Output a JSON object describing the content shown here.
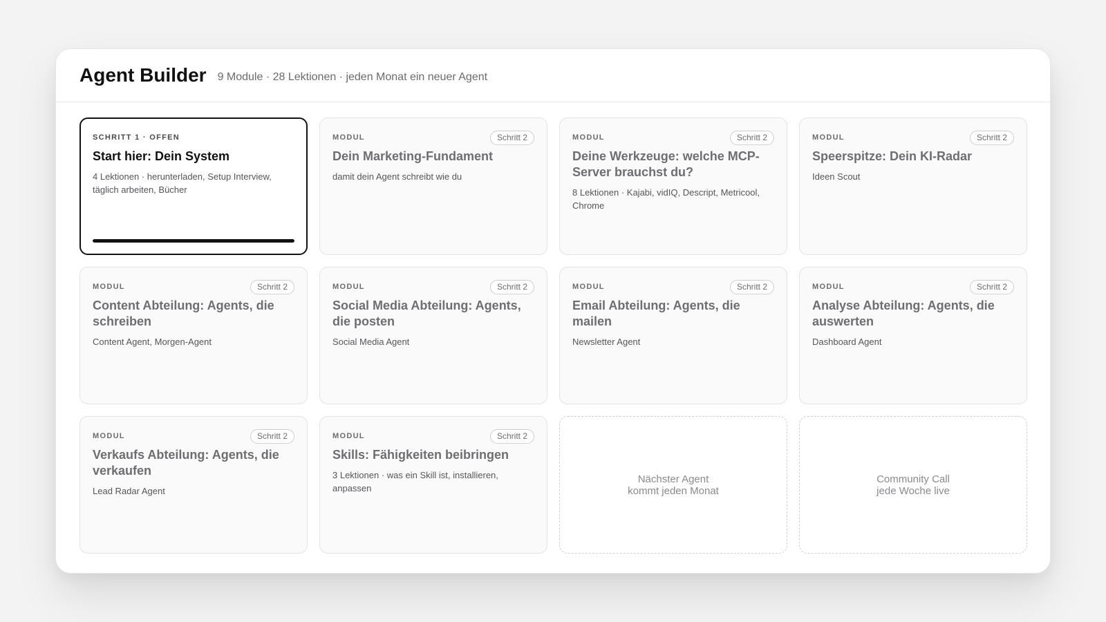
{
  "header": {
    "title": "Agent Builder",
    "subtitle": "9 Module · 28 Lektionen · jeden Monat ein neuer Agent"
  },
  "cards": [
    {
      "kicker": "SCHRITT 1 · OFFEN",
      "title": "Start hier: Dein System",
      "desc": "4 Lektionen · herunterladen, Setup Interview, täglich arbeiten, Bücher",
      "progress": 1.0
    },
    {
      "kicker": "MODUL",
      "badge": "Schritt 2",
      "title": "Dein Marketing-Fundament",
      "desc": "damit dein Agent schreibt wie du"
    },
    {
      "kicker": "MODUL",
      "badge": "Schritt 2",
      "title": "Deine Werkzeuge: welche MCP-Server brauchst du?",
      "desc": "8 Lektionen · Kajabi, vidIQ, Descript, Metricool, Chrome"
    },
    {
      "kicker": "MODUL",
      "badge": "Schritt 2",
      "title": "Speerspitze: Dein KI-Radar",
      "desc": "Ideen Scout"
    },
    {
      "kicker": "MODUL",
      "badge": "Schritt 2",
      "title": "Content Abteilung: Agents, die schreiben",
      "desc": "Content Agent, Morgen-Agent"
    },
    {
      "kicker": "MODUL",
      "badge": "Schritt 2",
      "title": "Social Media Abteilung: Agents, die posten",
      "desc": "Social Media Agent"
    },
    {
      "kicker": "MODUL",
      "badge": "Schritt 2",
      "title": "Email Abteilung: Agents, die mailen",
      "desc": "Newsletter Agent"
    },
    {
      "kicker": "MODUL",
      "badge": "Schritt 2",
      "title": "Analyse Abteilung: Agents, die auswerten",
      "desc": "Dashboard Agent"
    },
    {
      "kicker": "MODUL",
      "badge": "Schritt 2",
      "title": "Verkaufs Abteilung: Agents, die verkaufen",
      "desc": "Lead Radar Agent"
    },
    {
      "kicker": "MODUL",
      "badge": "Schritt 2",
      "title": "Skills: Fähigkeiten beibringen",
      "desc": "3 Lektionen · was ein Skill ist, installieren, anpassen"
    }
  ],
  "placeholders": [
    {
      "line1": "Nächster Agent",
      "line2": "kommt jeden Monat"
    },
    {
      "line1": "Community Call",
      "line2": "jede Woche live"
    }
  ]
}
